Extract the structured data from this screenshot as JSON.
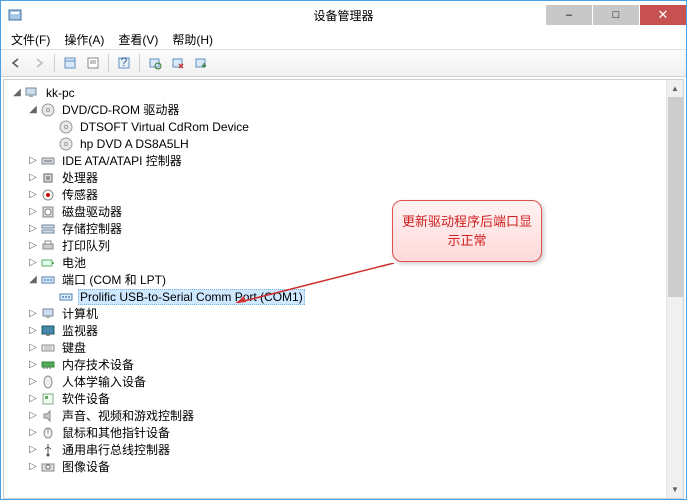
{
  "title": "设备管理器",
  "menus": [
    "文件(F)",
    "操作(A)",
    "查看(V)",
    "帮助(H)"
  ],
  "windowButtons": {
    "min": "–",
    "max": "□",
    "close": "✕"
  },
  "tree": {
    "root": "kk-pc",
    "nodes": [
      {
        "label": "DVD/CD-ROM 驱动器",
        "expanded": true,
        "icon": "disc",
        "children": [
          {
            "label": "DTSOFT Virtual CdRom Device",
            "icon": "disc"
          },
          {
            "label": "hp DVD A  DS8A5LH",
            "icon": "disc"
          }
        ]
      },
      {
        "label": "IDE ATA/ATAPI 控制器",
        "icon": "ide"
      },
      {
        "label": "处理器",
        "icon": "cpu"
      },
      {
        "label": "传感器",
        "icon": "sensor"
      },
      {
        "label": "磁盘驱动器",
        "icon": "hdd"
      },
      {
        "label": "存储控制器",
        "icon": "storage"
      },
      {
        "label": "打印队列",
        "icon": "printer"
      },
      {
        "label": "电池",
        "icon": "battery"
      },
      {
        "label": "端口 (COM 和 LPT)",
        "expanded": true,
        "icon": "port",
        "children": [
          {
            "label": "Prolific USB-to-Serial Comm Port (COM1)",
            "icon": "port",
            "selected": true
          }
        ]
      },
      {
        "label": "计算机",
        "icon": "computer"
      },
      {
        "label": "监视器",
        "icon": "monitor"
      },
      {
        "label": "键盘",
        "icon": "keyboard"
      },
      {
        "label": "内存技术设备",
        "icon": "memory"
      },
      {
        "label": "人体学输入设备",
        "icon": "hid"
      },
      {
        "label": "软件设备",
        "icon": "software"
      },
      {
        "label": "声音、视频和游戏控制器",
        "icon": "audio"
      },
      {
        "label": "鼠标和其他指针设备",
        "icon": "mouse"
      },
      {
        "label": "通用串行总线控制器",
        "icon": "usb"
      },
      {
        "label": "图像设备",
        "icon": "camera"
      }
    ]
  },
  "callout": "更新驱动程序后端口显示正常"
}
